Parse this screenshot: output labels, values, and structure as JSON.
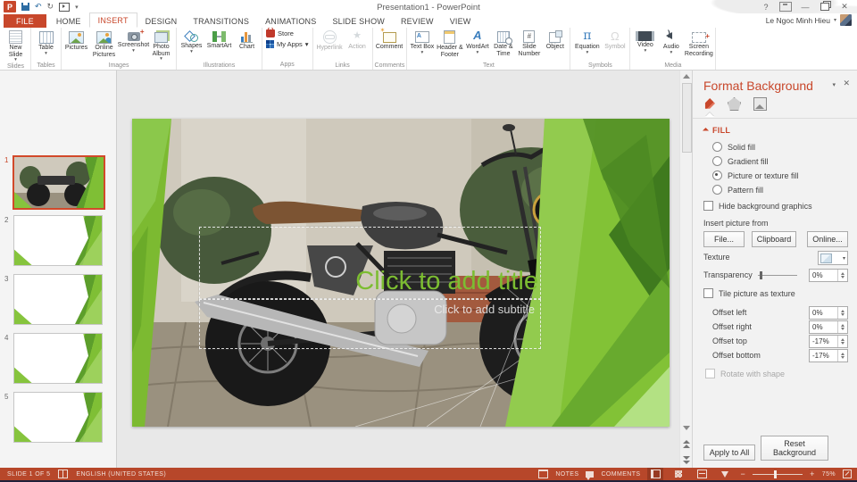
{
  "title_bar": {
    "title": "Presentation1 - PowerPoint",
    "user_name": "Le Ngoc Minh Hieu",
    "help": "?"
  },
  "icons": {
    "undo": "↶",
    "redo": "↻",
    "minimize": "—",
    "close": "✕",
    "dropdown": "▾",
    "collapse": "∧",
    "equation": "π",
    "symbol": "Ω",
    "wordart": "A",
    "slide_number": "#",
    "action": "★",
    "textbox": "A"
  },
  "tabs": [
    {
      "label": "FILE"
    },
    {
      "label": "HOME"
    },
    {
      "label": "INSERT"
    },
    {
      "label": "DESIGN"
    },
    {
      "label": "TRANSITIONS"
    },
    {
      "label": "ANIMATIONS"
    },
    {
      "label": "SLIDE SHOW"
    },
    {
      "label": "REVIEW"
    },
    {
      "label": "VIEW"
    }
  ],
  "ribbon": {
    "groups": [
      {
        "label": "Slides",
        "buttons": [
          {
            "label": "New Slide"
          }
        ]
      },
      {
        "label": "Tables",
        "buttons": [
          {
            "label": "Table"
          }
        ]
      },
      {
        "label": "Images",
        "buttons": [
          {
            "label": "Pictures"
          },
          {
            "label": "Online Pictures"
          },
          {
            "label": "Screenshot"
          },
          {
            "label": "Photo Album"
          }
        ]
      },
      {
        "label": "Illustrations",
        "buttons": [
          {
            "label": "Shapes"
          },
          {
            "label": "SmartArt"
          },
          {
            "label": "Chart"
          }
        ]
      },
      {
        "label": "Apps",
        "buttons": [
          {
            "label": "Store"
          },
          {
            "label": "My Apps"
          }
        ]
      },
      {
        "label": "Links",
        "buttons": [
          {
            "label": "Hyperlink"
          },
          {
            "label": "Action"
          }
        ]
      },
      {
        "label": "Comments",
        "buttons": [
          {
            "label": "Comment"
          }
        ]
      },
      {
        "label": "Text",
        "buttons": [
          {
            "label": "Text Box"
          },
          {
            "label": "Header & Footer"
          },
          {
            "label": "WordArt"
          },
          {
            "label": "Date & Time"
          },
          {
            "label": "Slide Number"
          },
          {
            "label": "Object"
          }
        ]
      },
      {
        "label": "Symbols",
        "buttons": [
          {
            "label": "Equation"
          },
          {
            "label": "Symbol"
          }
        ]
      },
      {
        "label": "Media",
        "buttons": [
          {
            "label": "Video"
          },
          {
            "label": "Audio"
          },
          {
            "label": "Screen Recording"
          }
        ]
      }
    ]
  },
  "slides_panel": {
    "thumbnails": [
      {
        "number": "1"
      },
      {
        "number": "2"
      },
      {
        "number": "3"
      },
      {
        "number": "4"
      },
      {
        "number": "5"
      }
    ]
  },
  "slide": {
    "title_placeholder": "Click to add title",
    "subtitle_placeholder": "Click to add subtitle"
  },
  "format_panel": {
    "title": "Format Background",
    "section": "FILL",
    "fill_options": [
      {
        "label": "Solid fill"
      },
      {
        "label": "Gradient fill"
      },
      {
        "label": "Picture or texture fill"
      },
      {
        "label": "Pattern fill"
      }
    ],
    "hide_bg_label": "Hide background graphics",
    "insert_from_label": "Insert picture from",
    "file_button": "File...",
    "clipboard_button": "Clipboard",
    "online_button": "Online...",
    "texture_label": "Texture",
    "transparency_label": "Transparency",
    "transparency_value": "0%",
    "tile_label": "Tile picture as texture",
    "offsets": [
      {
        "label": "Offset left",
        "value": "0%"
      },
      {
        "label": "Offset right",
        "value": "0%"
      },
      {
        "label": "Offset top",
        "value": "-17%"
      },
      {
        "label": "Offset bottom",
        "value": "-17%"
      }
    ],
    "rotate_label": "Rotate with shape",
    "apply_button": "Apply to All",
    "reset_button": "Reset Background"
  },
  "status_bar": {
    "slide_info": "SLIDE 1 OF 5",
    "language": "ENGLISH (UNITED STATES)",
    "notes_label": "NOTES",
    "comments_label": "COMMENTS",
    "zoom_level": "75%"
  },
  "colors": {
    "accent_red": "#B7472A",
    "ribbon_red": "#C8472B",
    "theme_green": "#7CBD31"
  }
}
